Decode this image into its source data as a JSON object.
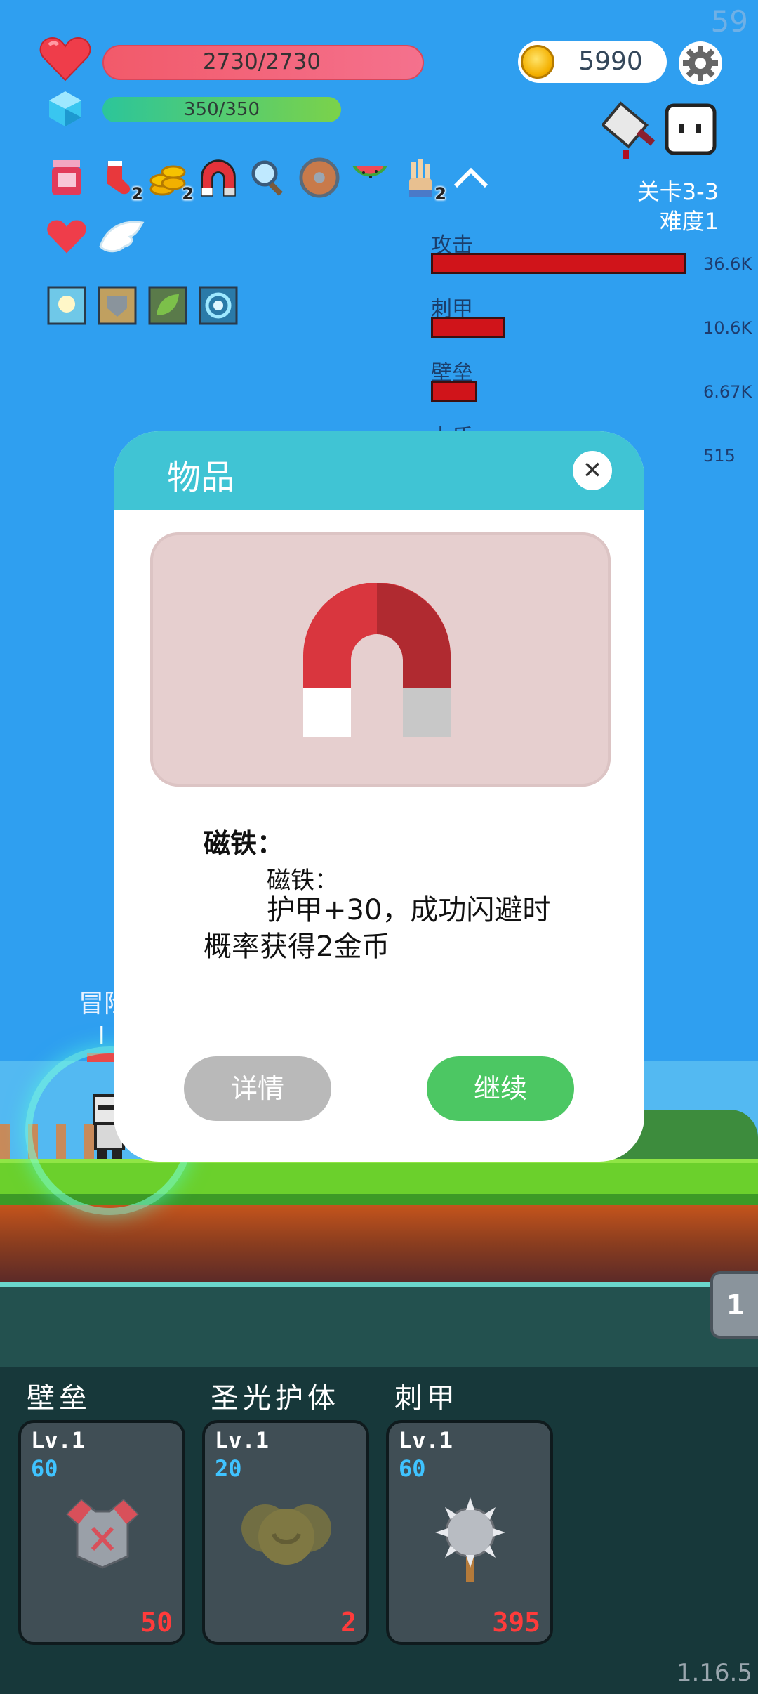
{
  "hud": {
    "fps": "59",
    "hp_text": "2730/2730",
    "mp_text": "350/350",
    "coins": "5990",
    "stage": "关卡3-3",
    "difficulty": "难度1",
    "item_badges": [
      "2",
      "2",
      "2"
    ]
  },
  "damage_stats": [
    {
      "label": "攻击",
      "value": "36.6K",
      "fraction": 1.0
    },
    {
      "label": "刺甲",
      "value": "10.6K",
      "fraction": 0.29
    },
    {
      "label": "壁垒",
      "value": "6.67K",
      "fraction": 0.18
    },
    {
      "label": "力盾",
      "value": "515",
      "fraction": 0.01
    }
  ],
  "hero": {
    "name_fragment": "冒险",
    "level_fragment": "l"
  },
  "modal": {
    "title": "物品",
    "close_symbol": "✕",
    "item_name": "磁铁：",
    "item_sub": "磁铁：",
    "item_desc": "护甲+30，成功闪避时概率获得2金币",
    "detail_button": "详情",
    "continue_button": "继续"
  },
  "side_tab": "1",
  "skills": [
    {
      "title": "壁垒",
      "level": "Lv.1",
      "value": "60",
      "cost": "50",
      "icon": "armor-icon"
    },
    {
      "title": "圣光护体",
      "level": "Lv.1",
      "value": "20",
      "cost": "2",
      "icon": "holy-shield-icon"
    },
    {
      "title": "刺甲",
      "level": "Lv.1",
      "value": "60",
      "cost": "395",
      "icon": "spiked-mace-icon"
    }
  ],
  "version": "1.16.5",
  "colors": {
    "sky": "#2f9ff0",
    "hp": "#f25a6a",
    "modal_header": "#40c4d4",
    "continue": "#4cc763",
    "detail": "#b9b9b9",
    "damage_bar": "#d0141a"
  }
}
